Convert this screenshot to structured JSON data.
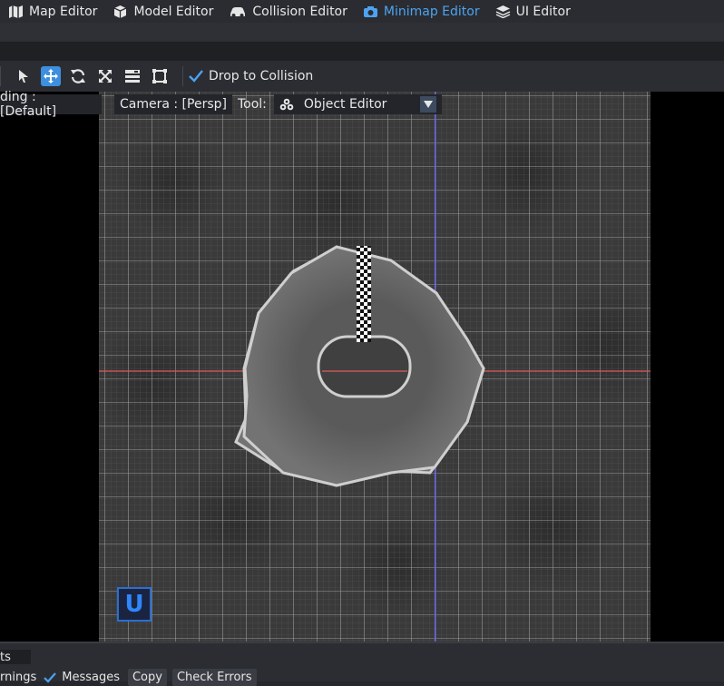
{
  "tabs": [
    {
      "label": "Map Editor",
      "icon": "map-icon"
    },
    {
      "label": "Model Editor",
      "icon": "cube-icon"
    },
    {
      "label": "Collision Editor",
      "icon": "car-icon"
    },
    {
      "label": "Minimap Editor",
      "icon": "camera-icon",
      "active": true
    },
    {
      "label": "UI Editor",
      "icon": "layers-icon"
    }
  ],
  "toolbar": {
    "tools": [
      "select-tool",
      "move-tool",
      "rotate-tool",
      "scale-tool",
      "align-tool",
      "bounds-tool"
    ],
    "active_tool": "move-tool",
    "drop_to_collision_label": "Drop to Collision",
    "drop_to_collision_checked": true
  },
  "viewport": {
    "shading_label": "ding : [Default]",
    "camera_label": "Camera : [Persp]",
    "tool_prefix": "Tool:",
    "tool_value": "Object Editor",
    "badge": "U"
  },
  "bottom": {
    "tab_label": "ts",
    "warnings_label": "rnings",
    "messages_label": "Messages",
    "messages_checked": true,
    "copy_label": "Copy",
    "check_errors_label": "Check Errors"
  },
  "colors": {
    "accent": "#3d8fe0",
    "active_tab": "#4da3f0",
    "axis_x": "#e05a5a",
    "axis_y": "#5a5aff",
    "badge": "#2f86ff"
  }
}
